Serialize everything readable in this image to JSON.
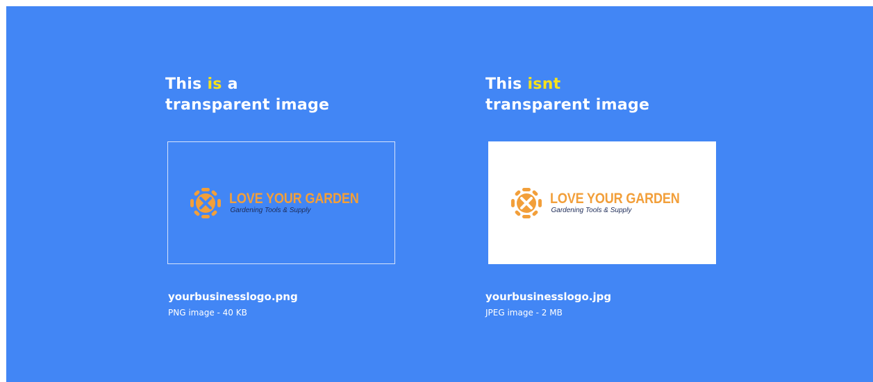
{
  "left": {
    "heading_pre": "This ",
    "heading_hl": "is",
    "heading_post": " a",
    "heading_line2": "transparent image",
    "logo_name": "LOVE YOUR GARDEN",
    "logo_tagline": "Gardening Tools & Supply",
    "file_name": "yourbusinesslogo.png",
    "file_meta": "PNG image - 40 KB"
  },
  "right": {
    "heading_pre": "This ",
    "heading_hl": "isnt",
    "heading_line2": "transparent image",
    "logo_name": "LOVE YOUR GARDEN",
    "logo_tagline": "Gardening Tools & Supply",
    "file_name": "yourbusinesslogo.jpg",
    "file_meta": "JPEG image - 2 MB"
  },
  "colors": {
    "background": "#4286f5",
    "highlight": "#f6e11c",
    "logo_orange": "#f29f3a",
    "tagline_navy": "#1d2b57"
  },
  "icons": {
    "logo_mark": "garden-flower-logo-icon"
  }
}
